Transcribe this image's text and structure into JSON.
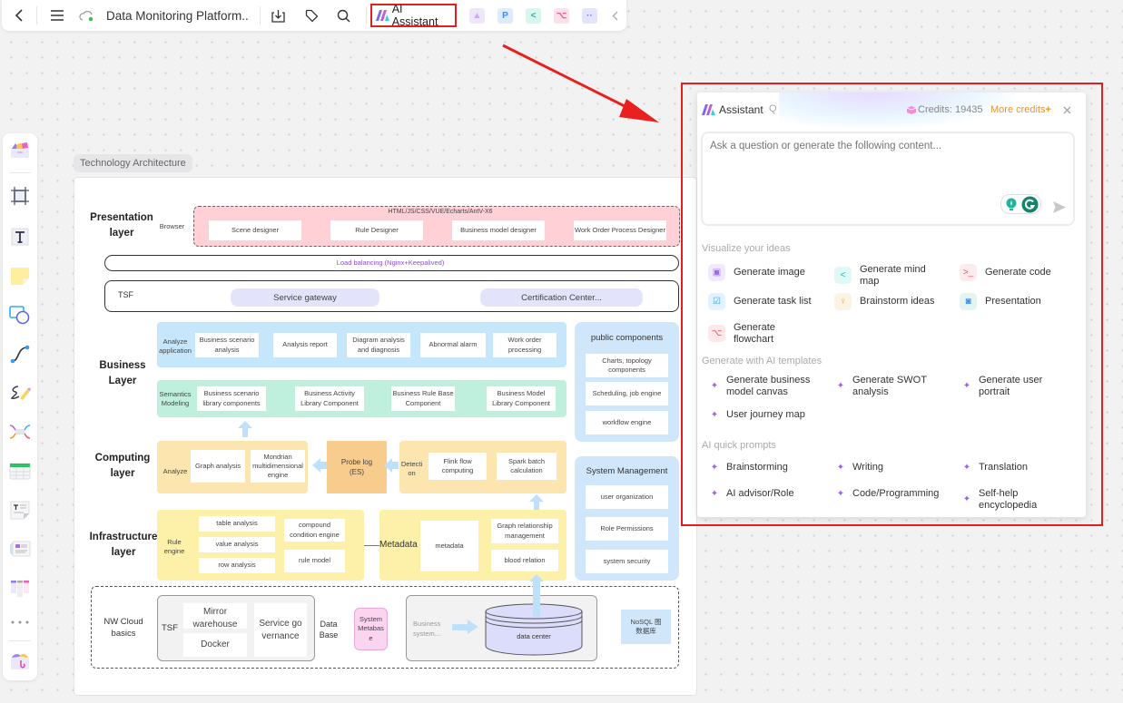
{
  "toolbar": {
    "back_icon": "chevron-left-icon",
    "menu_icon": "hamburger-icon",
    "cloud_icon": "cloud-sync-icon",
    "document_title": "Data Monitoring Platform..",
    "download_icon": "download-icon",
    "tag_icon": "tag-icon",
    "search_icon": "search-icon",
    "ai_assistant_label": "AI Assistant",
    "apps": [
      {
        "name": "image-generator-icon",
        "glyph": "▲",
        "color": "#c9a8f5",
        "bg": "#efe6fd"
      },
      {
        "name": "presentation-icon",
        "glyph": "P",
        "color": "#3a8ef0",
        "bg": "#dcecfd"
      },
      {
        "name": "mindmap-icon",
        "glyph": "<",
        "color": "#16b8a0",
        "bg": "#d6f6f0"
      },
      {
        "name": "flowchart-icon",
        "glyph": "⌥",
        "color": "#f05a8c",
        "bg": "#fde1ea"
      },
      {
        "name": "chat-icon",
        "glyph": "··",
        "color": "#6f7ef0",
        "bg": "#e2e5fd"
      }
    ],
    "collapse_icon": "chevron-left-icon"
  },
  "left_toolbar": {
    "items": [
      {
        "name": "templates-tool",
        "icon": "template-box-icon"
      },
      {
        "name": "frame-tool",
        "icon": "frame-icon"
      },
      {
        "name": "text-tool",
        "icon": "text-icon"
      },
      {
        "name": "sticky-note-tool",
        "icon": "sticky-note-icon"
      },
      {
        "name": "shape-tool",
        "icon": "shapes-icon"
      },
      {
        "name": "connector-tool",
        "icon": "connector-icon"
      },
      {
        "name": "pen-tool",
        "icon": "pen-icon"
      },
      {
        "name": "mindmap-tool",
        "icon": "mindmap-icon"
      },
      {
        "name": "table-tool",
        "icon": "table-icon"
      },
      {
        "name": "text-block-tool",
        "icon": "text-block-icon"
      },
      {
        "name": "card-tool",
        "icon": "card-icon"
      },
      {
        "name": "kanban-tool",
        "icon": "kanban-icon"
      },
      {
        "name": "more-tools",
        "icon": "more-icon"
      },
      {
        "name": "plugins-tool",
        "icon": "plugin-box-icon"
      }
    ]
  },
  "diagram": {
    "frame_label": "Technology Architecture",
    "presentation": {
      "title": "Presentation layer",
      "browser": "Browser",
      "tech": "HTML/JS/CSS/VUE/Echarts/AntV-X6",
      "items": [
        "Scene designer",
        "Rule Designer",
        "Business model designer",
        "Work Order Process Designer"
      ]
    },
    "load_balancing": "Load balancing (Nginx+Keepalived)",
    "tsf": {
      "label": "TSF",
      "items": [
        "Service gateway",
        "Certification Center..."
      ]
    },
    "business": {
      "title": "Business Layer",
      "analyze_label": "Analyze application",
      "analyze_items": [
        "Business scenario analysis",
        "Analysis report",
        "Diagram analysis and diagnosis",
        "Abnormal alarm",
        "Work order processing"
      ],
      "semantics_label": "Semantics Modeling",
      "semantics_items": [
        "Business scenario library components",
        "Business Activity Library Component",
        "Business Rule Base Component",
        "Business Model Library Component"
      ]
    },
    "computing": {
      "title": "Computing layer",
      "analyze_label": "Analyze",
      "analyze_items": [
        "Graph analysis",
        "Mondrian multidimensional engine"
      ],
      "probe": "Probe log (ES)",
      "detection_label": "Detection",
      "detection_items": [
        "Flink flow computing",
        "Spark batch calculation"
      ]
    },
    "infrastructure": {
      "title": "Infrastructure layer",
      "rule_engine_label": "Rule engine",
      "analysis_items": [
        "table analysis",
        "value analysis",
        "row analysis"
      ],
      "rule_items": [
        "compound condition engine",
        "rule model"
      ],
      "metadata_label": "Metadata",
      "metadata_box": "metadata",
      "metadata_items": [
        "Graph relationship management",
        "blood relation"
      ]
    },
    "public_components": {
      "title": "public components",
      "items": [
        "Charts, topology components",
        "Scheduling, job engine",
        "workflow engine"
      ]
    },
    "system_management": {
      "title": "System Management",
      "items": [
        "user organization",
        "Role Permissions",
        "system security"
      ]
    },
    "cloud": {
      "title": "NW Cloud basics",
      "tsf_label": "TSF",
      "items": [
        "Mirror warehouse",
        "Docker",
        "Service governance"
      ],
      "database_label": "Data Base",
      "system_metabase": "System Metabase",
      "business_system": "Business system...",
      "data_center": "data center",
      "nosql": "NoSQL 图数据库"
    }
  },
  "assistant": {
    "title": "Assistant",
    "help_icon": "question-icon",
    "credits_label": "Credits: 19435",
    "more_credits": "More credits",
    "close_icon": "close-icon",
    "input_placeholder": "Ask a question or generate the following content...",
    "send_icon": "send-icon",
    "sections": {
      "visualize": {
        "label": "Visualize your ideas",
        "items": [
          {
            "label": "Generate image",
            "icon": "image-icon",
            "color": "#9b6cf0",
            "bg": "#f1eafd",
            "glyph": "▣"
          },
          {
            "label": "Generate mind map",
            "icon": "mindmap-icon",
            "color": "#18bfa8",
            "bg": "#e1f8f4",
            "glyph": "<"
          },
          {
            "label": "Generate code",
            "icon": "code-icon",
            "color": "#f0506a",
            "bg": "#fdecee",
            "glyph": ">_"
          },
          {
            "label": "Generate task list",
            "icon": "task-list-icon",
            "color": "#3a9be8",
            "bg": "#e4f2fd",
            "glyph": "☑"
          },
          {
            "label": "Brainstorm ideas",
            "icon": "lightbulb-icon",
            "color": "#f0a030",
            "bg": "#fdf3e2",
            "glyph": "♀"
          },
          {
            "label": "Presentation",
            "icon": "presentation-icon",
            "color": "#3a8ef0",
            "bg": "#e2f5f2",
            "glyph": "◙"
          },
          {
            "label": "Generate flowchart",
            "icon": "flowchart-icon",
            "color": "#f05060",
            "bg": "#fde8ea",
            "glyph": "⌥"
          }
        ]
      },
      "templates": {
        "label": "Generate with AI templates",
        "items": [
          "Generate business model canvas",
          "Generate SWOT analysis",
          "Generate user portrait",
          "User journey map"
        ]
      },
      "quick_prompts": {
        "label": "AI quick prompts",
        "items": [
          "Brainstorming",
          "Writing",
          "Translation",
          "AI advisor/Role",
          "Code/Programming",
          "Self-help encyclopedia"
        ]
      }
    }
  },
  "colors": {
    "highlight_red": "#e02020",
    "more_credits": "#e8962a",
    "presentation_bg": "#ffd0d6",
    "business_blue": "#c6e6fb",
    "semantics_green": "#bff0de",
    "computing_orange": "#fde5b0",
    "probe_orange": "#f7cc8c",
    "infra_yellow": "#fdf0a8",
    "side_blue": "#cfe6fb",
    "service_purple": "#e3e4fc"
  }
}
